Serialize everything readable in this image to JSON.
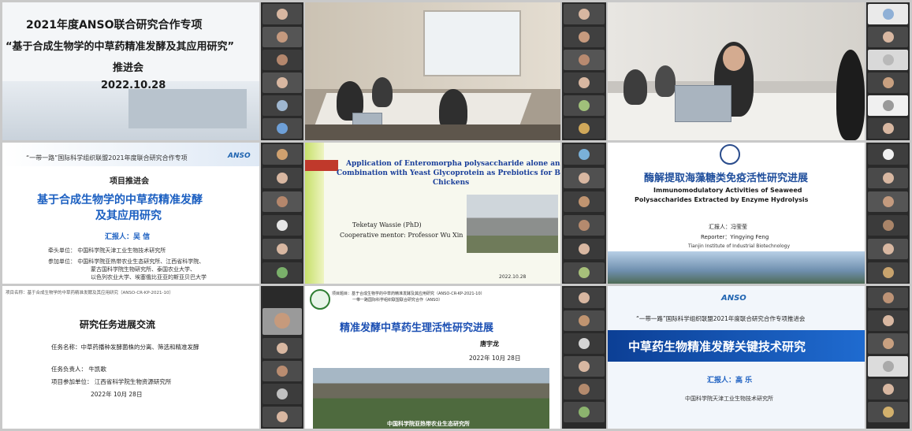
{
  "slides": {
    "s1": {
      "line1": "2021年度ANSO联合研究合作专项",
      "line2": "“基于合成生物学的中草药精准发酵及其应用研究”",
      "line3": "推进会",
      "date": "2022.10.28"
    },
    "s2": {
      "top": "“一带一路”国际科学组织联盟2021年度联合研究合作专项",
      "logo": "ANSO",
      "subtitle": "项目推进会",
      "title1": "基于合成生物学的中草药精准发酵",
      "title2": "及其应用研究",
      "reporter": "汇报人：吴 信",
      "unit1": "牵头单位：  中国科学院天津工业生物技术研究所",
      "unit2": "参加单位：  中国科学院亚热带农业生态研究所、江西省科学院、",
      "unit3": "蒙古国科学院生物研究所、泰国农业大学、",
      "unit4": "以色列农业大学、埃塞俄比亚亚的斯亚贝巴大学"
    },
    "s3": {
      "title1": "Application of Enteromorpha polysaccharide alone and in",
      "title2": "Combination with Yeast Glycoprotein as Prebiotics for Broiler",
      "title3": "Chickens",
      "name": "Teketay Wassie (PhD)",
      "mentor": "Cooperative mentor: Professor Wu Xin",
      "date": "2022.10.28"
    },
    "s4": {
      "cn_title": "酶解提取海藻糖类免疫活性研究进展",
      "en_title1": "Immunomodulatory Activities of Seaweed",
      "en_title2": "Polysaccharides Extracted by Enzyme Hydrolysis",
      "reporter_cn": "汇报人：冯莹莹",
      "reporter_en": "Reporter：Yingying Feng",
      "inst": "Tianjin Institute of Industrial Biotechnology"
    },
    "s5": {
      "header": "项目名称：基于合成生物学的中草药精准发酵及其应用研究（ANSO-CR-KP-2021-10）",
      "title": "研究任务进展交流",
      "task": "任务名称：中草药播种发酵菌株的分离、筛选和精准发酵",
      "leader": "任务负责人：  牛凯歌",
      "unit": "项目参加单位：  江西省科学院生物资源研究所",
      "date": "2022年 10月 28日"
    },
    "s6": {
      "header1": "项目题目：基于合成生物学的中草药精准发酵及其应用研究（ANSO-CR-KP-2021-10）",
      "header2": "一带一路国际科学组织联盟联合研究合作（ANSO）",
      "title": "精准发酵中草药生理活性研究进展",
      "name": "唐宇龙",
      "date": "2022年 10月 28日",
      "caption": "中国科学院亚热带农业生态研究所"
    },
    "s7": {
      "logo": "ANSO",
      "top": "“一带一路”国际科学组织联盟2021年度联合研究合作专项推进会",
      "title": "中草药生物精准发酵关键技术研究",
      "reporter": "汇报人：高 乐",
      "inst": "中国科学院天津工业生物技术研究所"
    }
  }
}
